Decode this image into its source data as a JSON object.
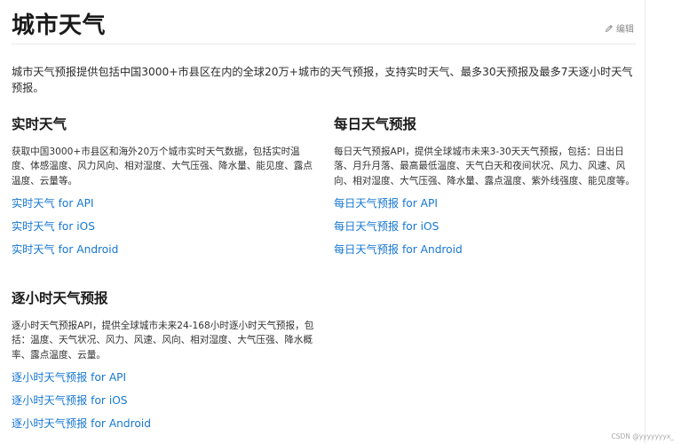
{
  "page": {
    "title": "城市天气",
    "edit_label": "编辑",
    "intro": "城市天气预报提供包括中国3000+市县区在内的全球20万+城市的天气预报，支持实时天气、最多30天预报及最多7天逐小时天气预报。"
  },
  "sections": {
    "realtime": {
      "title": "实时天气",
      "description": "获取中国3000+市县区和海外20万个城市实时天气数据，包括实时温度、体感温度、风力风向、相对湿度、大气压强、降水量、能见度、露点温度、云量等。",
      "links": [
        "实时天气 for API",
        "实时天气 for iOS",
        "实时天气 for Android"
      ]
    },
    "daily": {
      "title": "每日天气预报",
      "description": "每日天气预报API，提供全球城市未来3-30天天气预报，包括：日出日落、月升月落、最高最低温度、天气白天和夜间状况、风力、风速、风向、相对湿度、大气压强、降水量、露点温度、紫外线强度、能见度等。",
      "links": [
        "每日天气预报 for API",
        "每日天气预报 for iOS",
        "每日天气预报 for Android"
      ]
    },
    "hourly": {
      "title": "逐小时天气预报",
      "description": "逐小时天气预报API，提供全球城市未来24-168小时逐小时天气预报，包括：温度、天气状况、风力、风速、风向、相对湿度、大气压强、降水概率、露点温度、云量。",
      "links": [
        "逐小时天气预报 for API",
        "逐小时天气预报 for iOS",
        "逐小时天气预报 for Android"
      ]
    }
  },
  "watermark": "CSDN @yyyyyyyx_",
  "colors": {
    "link": "#1677d2",
    "title": "#1a1a1a",
    "muted": "#888888"
  },
  "icons": {
    "edit": "pencil-icon"
  }
}
